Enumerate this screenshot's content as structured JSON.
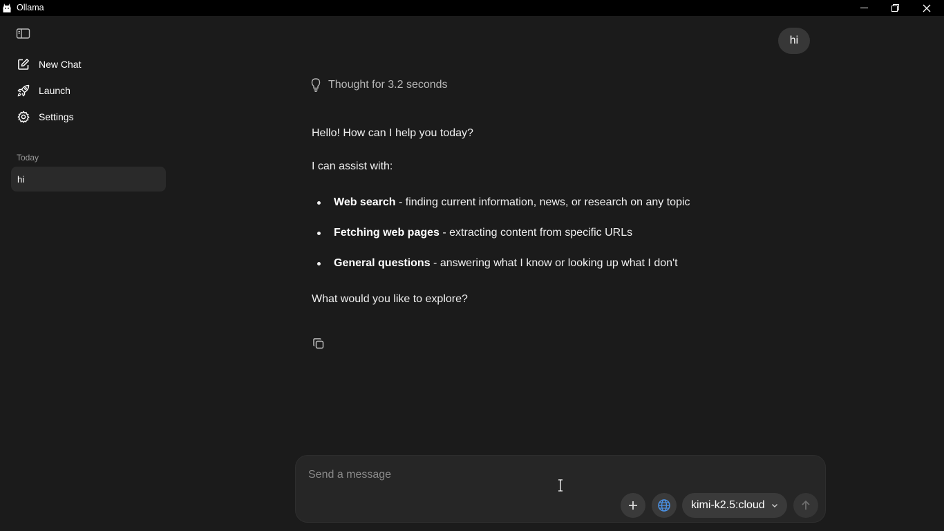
{
  "window": {
    "title": "Ollama"
  },
  "sidebar": {
    "nav": [
      {
        "label": "New Chat",
        "icon": "new-chat-icon"
      },
      {
        "label": "Launch",
        "icon": "rocket-icon"
      },
      {
        "label": "Settings",
        "icon": "gear-icon"
      }
    ],
    "section_label": "Today",
    "chats": [
      {
        "title": "hi",
        "selected": true
      }
    ]
  },
  "conversation": {
    "user_message": "hi",
    "thought_label": "Thought for 3.2 seconds",
    "reply": {
      "greeting": "Hello! How can I help you today?",
      "intro": "I can assist with:",
      "bullets": [
        {
          "bold": "Web search",
          "text": " - finding current information, news, or research on any topic"
        },
        {
          "bold": "Fetching web pages",
          "text": " - extracting content from specific URLs"
        },
        {
          "bold": "General questions",
          "text": " - answering what I know or looking up what I don't"
        }
      ],
      "closing": "What would you like to explore?"
    }
  },
  "composer": {
    "placeholder": "Send a message",
    "value": "",
    "model": "kimi-k2.5:cloud",
    "web_search_color": "#4a90e2"
  }
}
